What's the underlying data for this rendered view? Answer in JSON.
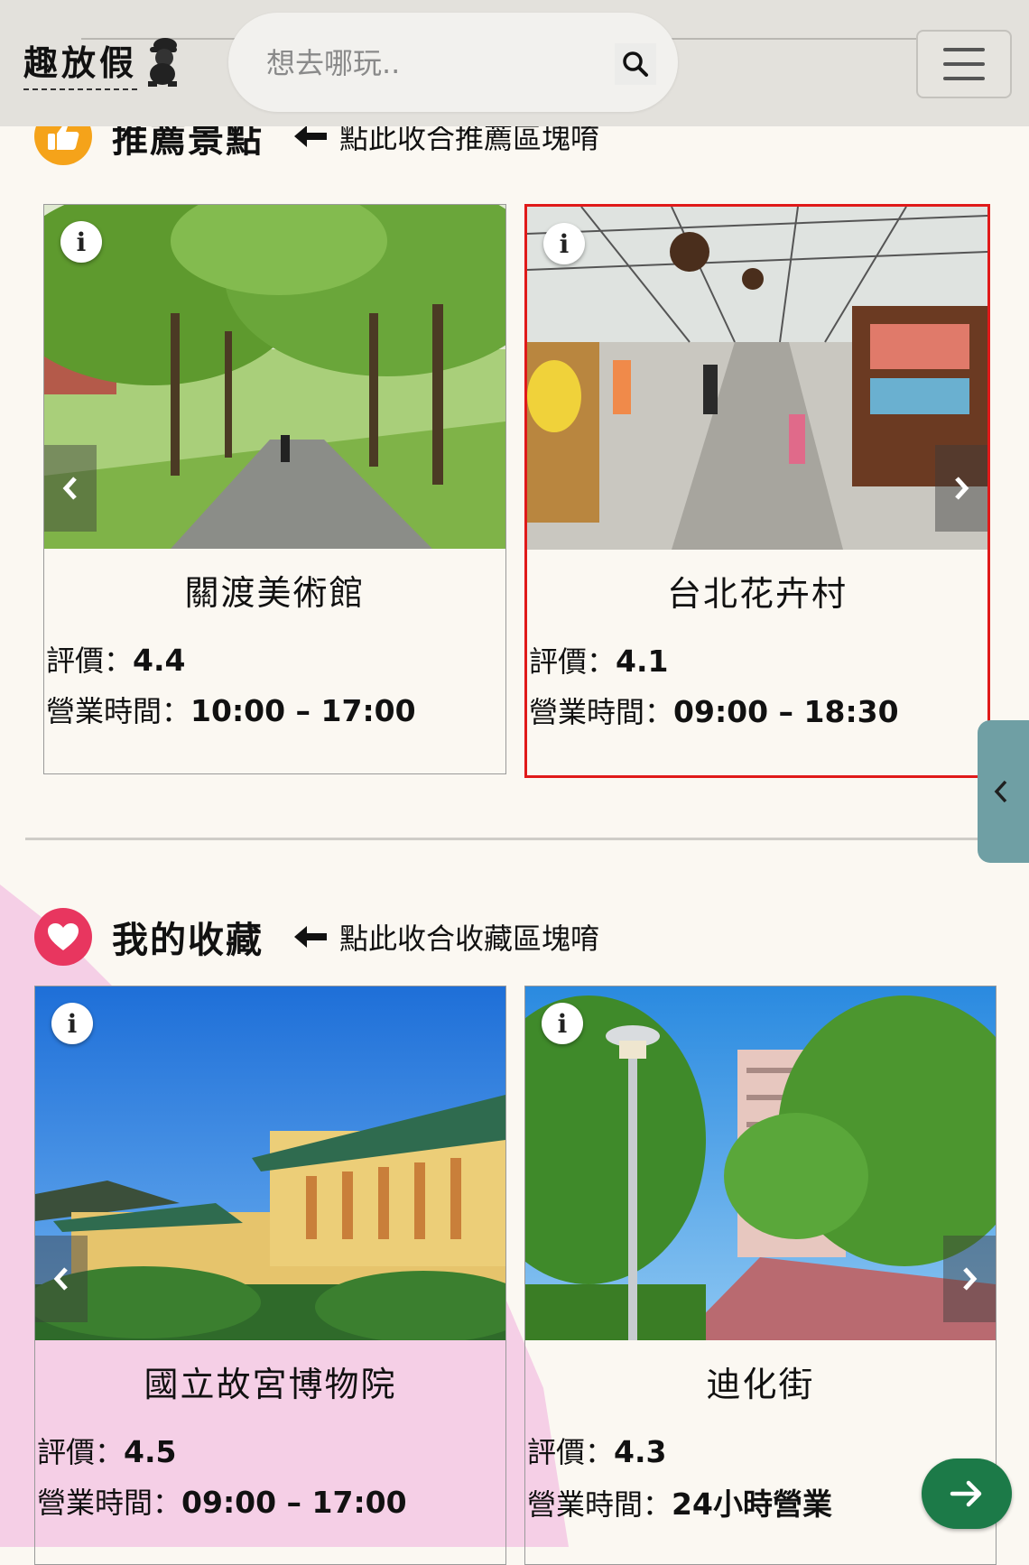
{
  "header": {
    "logo_text": "趣放假",
    "search_placeholder": "想去哪玩..",
    "search_icon": "search-icon",
    "menu_icon": "hamburger-menu-icon"
  },
  "recommended": {
    "title": "推薦景點",
    "hint": "點此收合推薦區塊唷",
    "icon": "thumbs-up-icon",
    "accent": "#f5a31a",
    "cards": [
      {
        "name": "關渡美術館",
        "rating_label": "評價：",
        "rating": "4.4",
        "hours_label": "營業時間：",
        "hours": "10:00 – 17:00"
      },
      {
        "name": "台北花卉村",
        "rating_label": "評價：",
        "rating": "4.1",
        "hours_label": "營業時間：",
        "hours": "09:00 – 18:30"
      }
    ]
  },
  "favorites": {
    "title": "我的收藏",
    "hint": "點此收合收藏區塊唷",
    "icon": "heart-icon",
    "accent": "#e8365f",
    "cards": [
      {
        "name": "國立故宮博物院",
        "rating_label": "評價：",
        "rating": "4.5",
        "hours_label": "營業時間：",
        "hours": "09:00 – 17:00"
      },
      {
        "name": "迪化街",
        "rating_label": "評價：",
        "rating": "4.3",
        "hours_label": "營業時間：",
        "hours": "24小時營業"
      }
    ]
  },
  "colors": {
    "selected_border": "#e01a1a",
    "side_tab": "#6f9fa4",
    "fab": "#1c7a48",
    "pink_bg": "#f5cfe6"
  }
}
